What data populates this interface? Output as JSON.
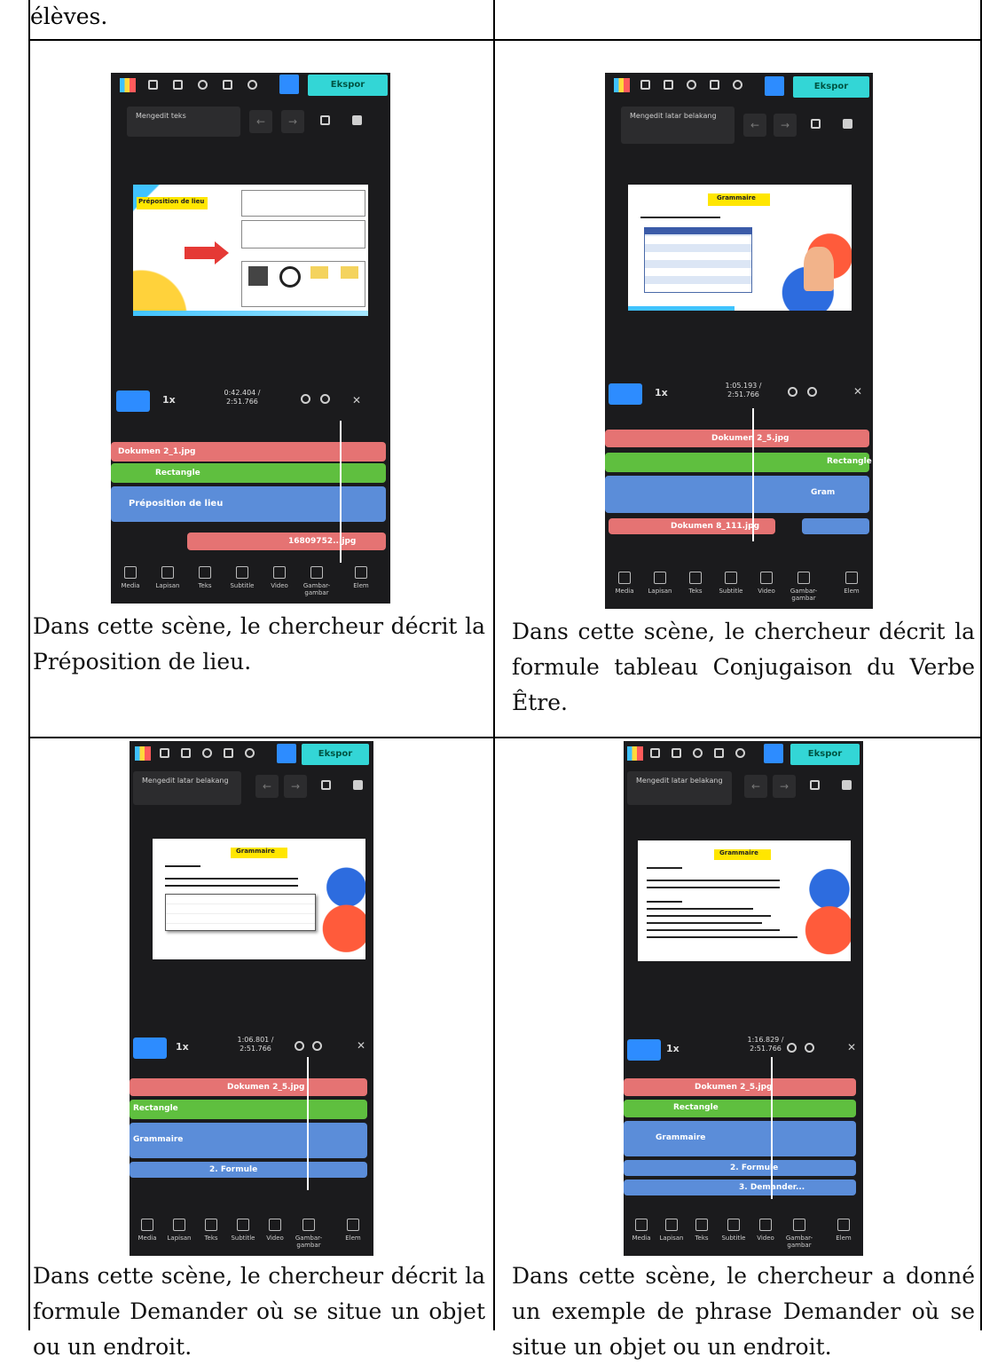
{
  "top_caption": "élèves.",
  "cells": [
    {
      "caption": "Dans cette scène, le chercheur décrit la Préposition de lieu.",
      "phone": {
        "export_label": "Ekspor",
        "edit_label": "Mengedit teks",
        "time": "0:42.404 /\n2:51.766",
        "speed": "1x",
        "slide_title": "Préposition de lieu",
        "tracks": [
          "Dokumen 2_1.jpg",
          "Rectangle",
          "Préposition de lieu",
          "16809752...jpg"
        ]
      }
    },
    {
      "caption": "Dans cette scène, le chercheur décrit la formule tableau Conjugaison du Verbe Être.",
      "phone": {
        "export_label": "Ekspor",
        "edit_label": "Mengedit latar belakang",
        "time": "1:05.193 /\n2:51.766",
        "speed": "1x",
        "slide_title": "Grammaire",
        "tracks": [
          "Dokumen 2_5.jpg",
          "Rectangle",
          "Gram",
          "Dokumen 8_111.jpg"
        ]
      }
    },
    {
      "caption": "Dans cette scène, le chercheur décrit la formule Demander où se situe un objet ou un endroit.",
      "phone": {
        "export_label": "Ekspor",
        "edit_label": "Mengedit latar belakang",
        "time": "1:06.801 /\n2:51.766",
        "speed": "1x",
        "slide_title": "Grammaire",
        "tracks": [
          "Dokumen 2_5.jpg",
          "Rectangle",
          "Grammaire",
          "2. Formule"
        ]
      }
    },
    {
      "caption": "Dans cette scène, le chercheur a donné un exemple de phrase Demander où se situe un objet ou un endroit.",
      "phone": {
        "export_label": "Ekspor",
        "edit_label": "Mengedit latar belakang",
        "time": "1:16.829 /\n2:51.766",
        "speed": "1x",
        "slide_title": "Grammaire",
        "tracks": [
          "Dokumen 2_5.jpg",
          "Rectangle",
          "Grammaire",
          "2. Formule",
          "3. Demander...",
          "..."
        ]
      }
    }
  ],
  "nav_items": [
    "Media",
    "Lapisan",
    "Teks",
    "Subtitle",
    "Video",
    "Gambar-gambar",
    "Elem"
  ]
}
